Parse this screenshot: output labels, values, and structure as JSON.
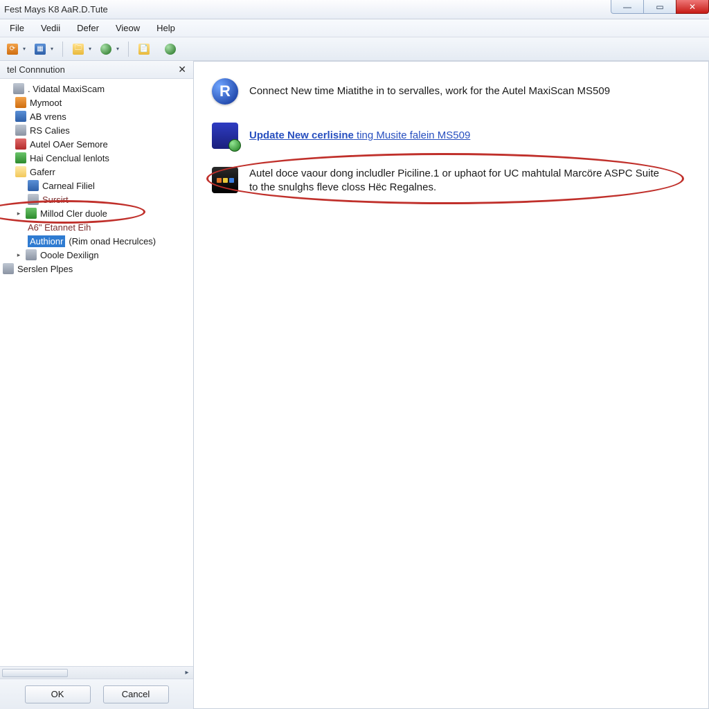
{
  "titlebar": {
    "title": "Fest Mays K8 AaR.D.Tute"
  },
  "menu": {
    "file": "File",
    "vedii": "Vedii",
    "defer": "Defer",
    "vieow": "Vieow",
    "help": "Help"
  },
  "left_panel": {
    "title": "tel Connnution",
    "root": ". Vidatal MaxiScam",
    "items": {
      "n0": "Mymoot",
      "n1": "AB vrens",
      "n2": "RS Calies",
      "n3": "Autel OAer Semore",
      "n4": "Hai Cenclual lenlots",
      "n5": "Gaferr",
      "n6": "Carneal Filiel",
      "n7": "Sursirt",
      "n8": "Millod Cler duole",
      "n9": "A6\" Etannet Eih",
      "n10_sel": "Authionr",
      "n10_rest": " (Rim onad Hecrulces)",
      "n11": "Ooole Dexilign",
      "n12": "Serslen Plpes"
    },
    "ok": "OK",
    "cancel": "Cancel"
  },
  "main": {
    "row1": "Connect New time Miatithe in to servalles, work for the Autel MaxiScan MS509",
    "row2_bold": "Update New cerlisine",
    "row2_rest": " ting Musite falein MS509",
    "row3": "Autel doce vaour dong includler Piciline.1 or uphaot for UC mahtulal Marcöre ASPC Suite to the snulghs fleve closs Hëc Regalnes."
  },
  "icons": {
    "r_letter": "R"
  }
}
